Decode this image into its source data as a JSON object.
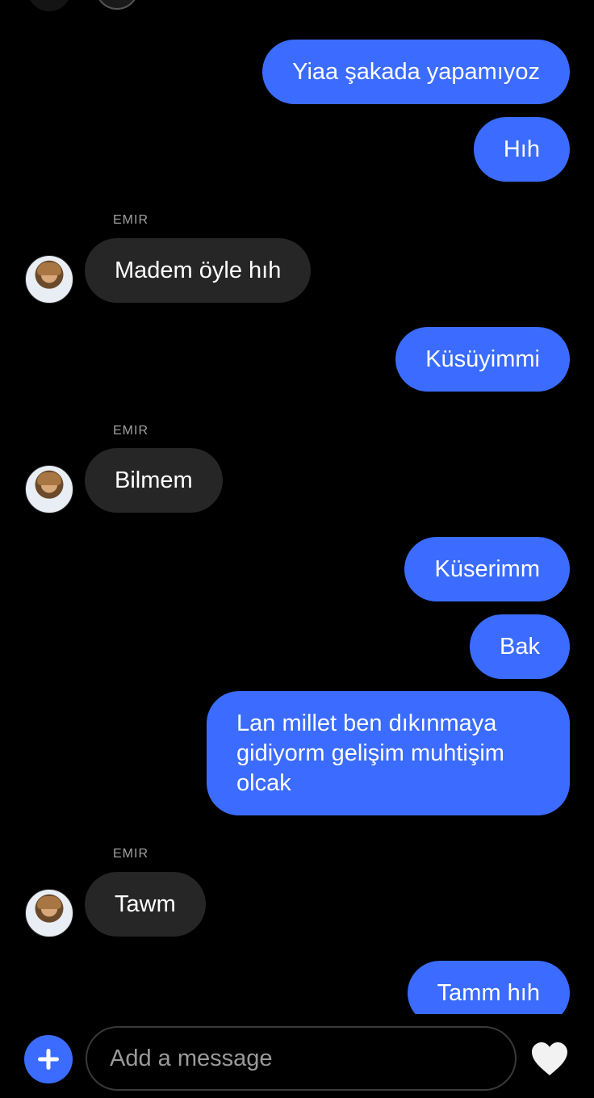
{
  "messages": [
    {
      "from": "me",
      "text": "Yiaa şakada yapamıyoz"
    },
    {
      "from": "me",
      "text": "Hıh"
    },
    {
      "from": "them",
      "sender": "EMIR",
      "text": "Madem öyle hıh"
    },
    {
      "from": "me",
      "text": "Küsüyimmi"
    },
    {
      "from": "them",
      "sender": "EMIR",
      "text": "Bilmem"
    },
    {
      "from": "me",
      "text": "Küserimm"
    },
    {
      "from": "me",
      "text": "Bak"
    },
    {
      "from": "me",
      "text": "Lan millet ben dıkınmaya gidiyorm gelişim muhtişim olcak"
    },
    {
      "from": "them",
      "sender": "EMIR",
      "text": "Tawm"
    },
    {
      "from": "me",
      "text": "Tamm hıh"
    }
  ],
  "composer": {
    "placeholder": "Add a message",
    "add_icon": "plus-icon",
    "like_icon": "heart-icon"
  },
  "colors": {
    "outgoing": "#3b6cff",
    "incoming": "#262626",
    "background": "#000000"
  }
}
